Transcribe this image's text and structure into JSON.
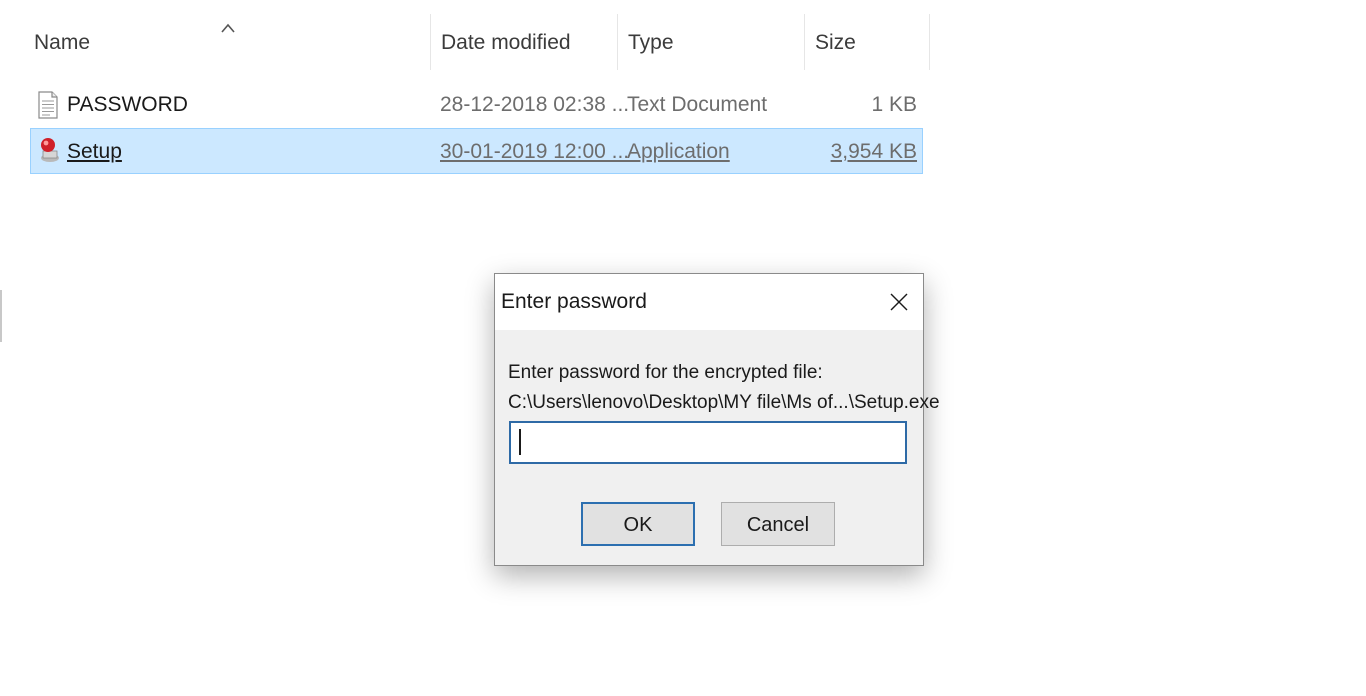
{
  "list": {
    "columns": {
      "name": "Name",
      "date_modified": "Date modified",
      "type": "Type",
      "size": "Size"
    },
    "sort_indicator_icon": "chevron-up-icon",
    "files": [
      {
        "name": "PASSWORD",
        "date_modified": "28-12-2018 02:38 ...",
        "type": "Text Document",
        "size": "1 KB",
        "icon": "text-document-icon",
        "selected": false
      },
      {
        "name": "Setup",
        "date_modified": "30-01-2019 12:00 ...",
        "type": "Application",
        "size": "3,954 KB",
        "icon": "setup-application-icon",
        "selected": true
      }
    ]
  },
  "dialog": {
    "title": "Enter password",
    "close_icon": "close-icon",
    "prompt": "Enter password for the encrypted file:",
    "file_path": "C:\\Users\\lenovo\\Desktop\\MY file\\Ms of...\\Setup.exe",
    "password_value": "",
    "ok_label": "OK",
    "cancel_label": "Cancel"
  },
  "colors": {
    "selection_fill": "#cce8ff",
    "selection_border": "#99d1ff",
    "input_focus_border": "#2e6aa6",
    "default_button_border": "#2c6fb0",
    "dialog_body": "#f0f0f0"
  }
}
